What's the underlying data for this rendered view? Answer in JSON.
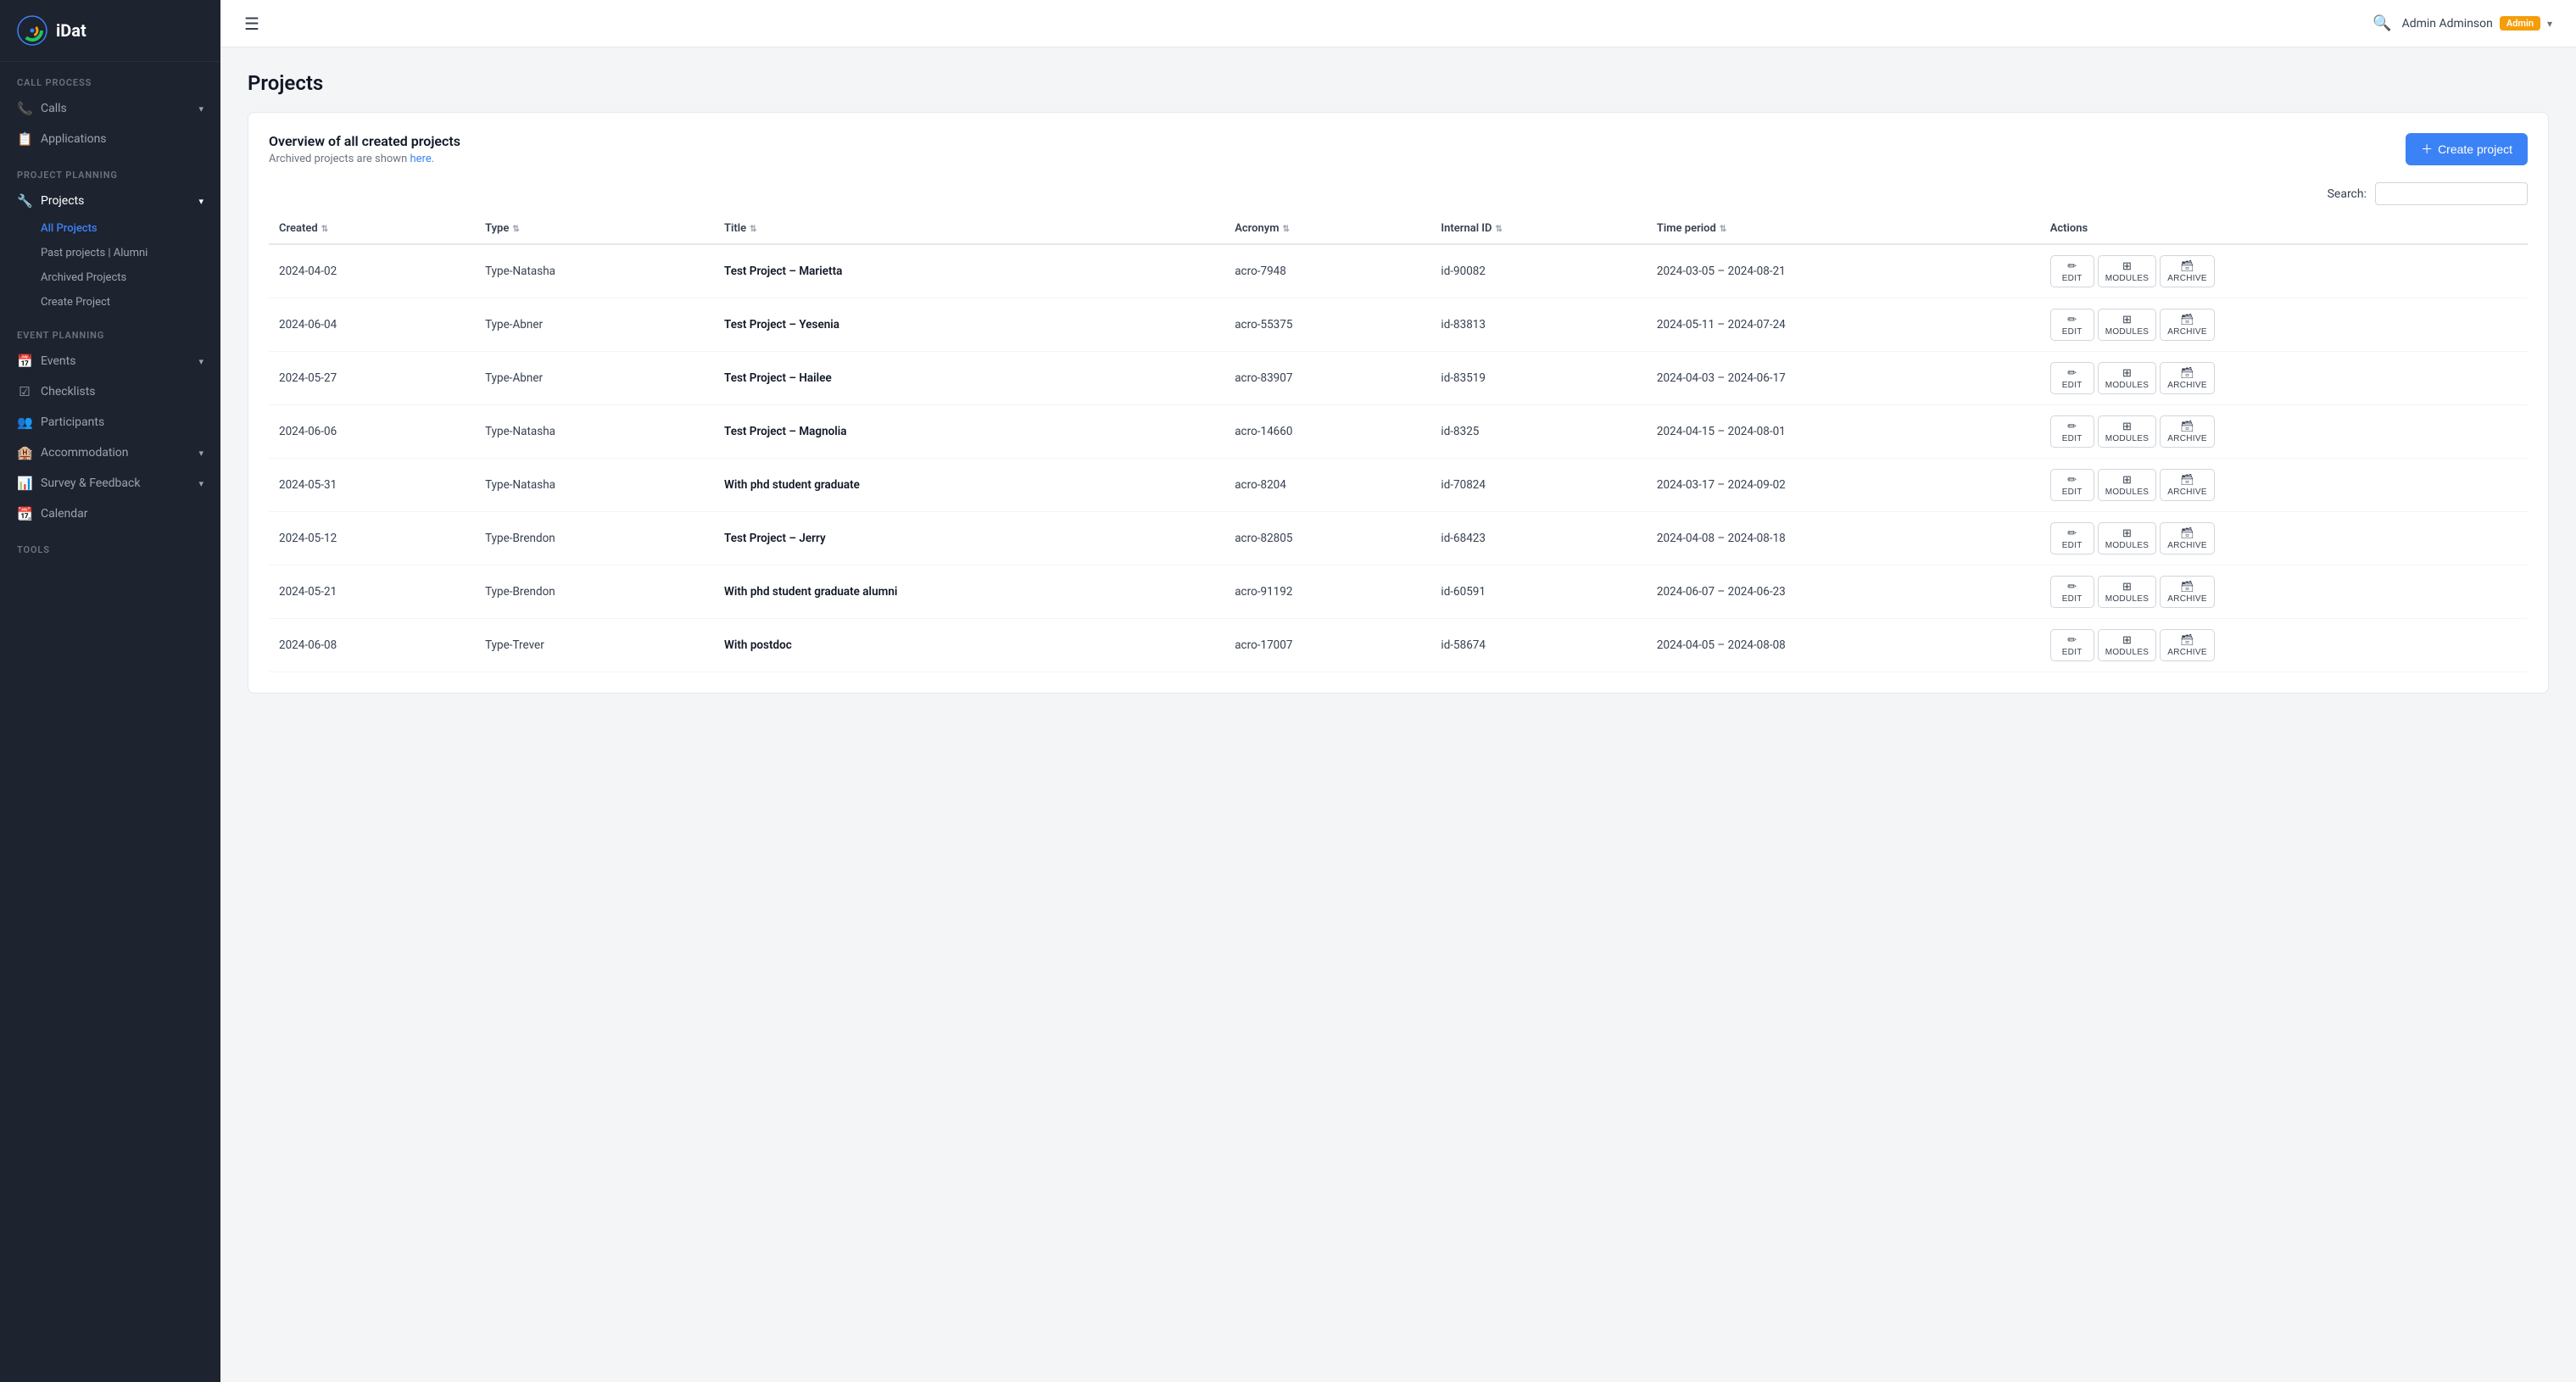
{
  "sidebar": {
    "logo_text": "iDat",
    "sections": [
      {
        "label": "Call Process",
        "items": [
          {
            "id": "calls",
            "icon": "📞",
            "label": "Calls",
            "has_chevron": true
          },
          {
            "id": "applications",
            "icon": "📋",
            "label": "Applications",
            "has_chevron": false
          }
        ]
      },
      {
        "label": "Project Planning",
        "items": [
          {
            "id": "projects",
            "icon": "🔧",
            "label": "Projects",
            "has_chevron": true,
            "active": true,
            "sub_items": [
              {
                "id": "all-projects",
                "label": "All Projects",
                "active": true
              },
              {
                "id": "past-projects",
                "label": "Past projects | Alumni",
                "active": false
              },
              {
                "id": "archived-projects",
                "label": "Archived Projects",
                "active": false
              },
              {
                "id": "create-project",
                "label": "Create Project",
                "active": false
              }
            ]
          }
        ]
      },
      {
        "label": "Event Planning",
        "items": [
          {
            "id": "events",
            "icon": "📅",
            "label": "Events",
            "has_chevron": true
          },
          {
            "id": "checklists",
            "icon": "☑",
            "label": "Checklists",
            "has_chevron": false
          },
          {
            "id": "participants",
            "icon": "👥",
            "label": "Participants",
            "has_chevron": false
          },
          {
            "id": "accommodation",
            "icon": "🏨",
            "label": "Accommodation",
            "has_chevron": true
          },
          {
            "id": "survey-feedback",
            "icon": "📊",
            "label": "Survey & Feedback",
            "has_chevron": true
          },
          {
            "id": "calendar",
            "icon": "📆",
            "label": "Calendar",
            "has_chevron": false
          }
        ]
      },
      {
        "label": "Tools",
        "items": []
      }
    ]
  },
  "topbar": {
    "hamburger_icon": "☰",
    "user_name": "Admin Adminson",
    "admin_badge": "Admin",
    "dropdown_arrow": "▾",
    "search_icon": "🔍"
  },
  "page": {
    "title": "Projects",
    "card": {
      "heading": "Overview of all created projects",
      "subtitle_prefix": "Archived projects are shown ",
      "subtitle_link": "here.",
      "create_btn_label": "Create project",
      "search_label": "Search:"
    },
    "table": {
      "columns": [
        {
          "key": "created",
          "label": "Created"
        },
        {
          "key": "type",
          "label": "Type"
        },
        {
          "key": "title",
          "label": "Title"
        },
        {
          "key": "acronym",
          "label": "Acronym"
        },
        {
          "key": "internal_id",
          "label": "Internal ID"
        },
        {
          "key": "time_period",
          "label": "Time period"
        },
        {
          "key": "actions",
          "label": "Actions"
        }
      ],
      "rows": [
        {
          "created": "2024-04-02",
          "type": "Type-Natasha",
          "title": "Test Project – Marietta",
          "acronym": "acro-7948",
          "internal_id": "id-90082",
          "time_period": "2024-03-05 – 2024-08-21"
        },
        {
          "created": "2024-06-04",
          "type": "Type-Abner",
          "title": "Test Project – Yesenia",
          "acronym": "acro-55375",
          "internal_id": "id-83813",
          "time_period": "2024-05-11 – 2024-07-24"
        },
        {
          "created": "2024-05-27",
          "type": "Type-Abner",
          "title": "Test Project – Hailee",
          "acronym": "acro-83907",
          "internal_id": "id-83519",
          "time_period": "2024-04-03 – 2024-06-17"
        },
        {
          "created": "2024-06-06",
          "type": "Type-Natasha",
          "title": "Test Project – Magnolia",
          "acronym": "acro-14660",
          "internal_id": "id-8325",
          "time_period": "2024-04-15 – 2024-08-01"
        },
        {
          "created": "2024-05-31",
          "type": "Type-Natasha",
          "title": "With phd student graduate",
          "acronym": "acro-8204",
          "internal_id": "id-70824",
          "time_period": "2024-03-17 – 2024-09-02"
        },
        {
          "created": "2024-05-12",
          "type": "Type-Brendon",
          "title": "Test Project – Jerry",
          "acronym": "acro-82805",
          "internal_id": "id-68423",
          "time_period": "2024-04-08 – 2024-08-18"
        },
        {
          "created": "2024-05-21",
          "type": "Type-Brendon",
          "title": "With phd student graduate alumni",
          "acronym": "acro-91192",
          "internal_id": "id-60591",
          "time_period": "2024-06-07 – 2024-06-23"
        },
        {
          "created": "2024-06-08",
          "type": "Type-Trever",
          "title": "With postdoc",
          "acronym": "acro-17007",
          "internal_id": "id-58674",
          "time_period": "2024-04-05 – 2024-08-08"
        }
      ],
      "action_buttons": [
        {
          "id": "edit",
          "icon": "✏",
          "label": "EDIT"
        },
        {
          "id": "modules",
          "icon": "⊞",
          "label": "MODULES"
        },
        {
          "id": "archive",
          "icon": "🗃",
          "label": "ARCHIVE"
        }
      ]
    }
  }
}
